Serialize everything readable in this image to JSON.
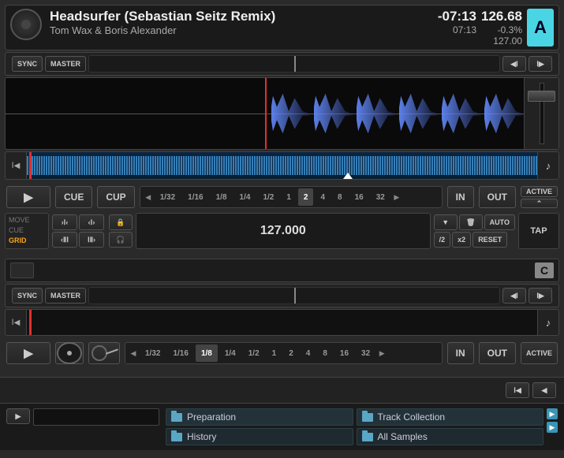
{
  "deckA": {
    "letter": "A",
    "title": "Headsurfer (Sebastian Seitz Remix)",
    "artist": "Tom Wax & Boris Alexander",
    "time_remaining": "-07:13",
    "time_elapsed": "07:13",
    "bpm_current": "126.68",
    "bpm_pct": "-0.3%",
    "bpm_orig": "127.00",
    "sync": "SYNC",
    "master": "MASTER",
    "play": "▶",
    "cue": "CUE",
    "cup": "CUP",
    "in": "IN",
    "out": "OUT",
    "active": "ACTIVE",
    "beats": [
      "1/32",
      "1/16",
      "1/8",
      "1/4",
      "1/2",
      "1",
      "2",
      "4",
      "8",
      "16",
      "32"
    ],
    "beats_selected": "2",
    "grid_tabs": {
      "move": "MOVE",
      "cue": "CUE",
      "grid": "GRID"
    },
    "bpm_field": "127.000",
    "auto": "AUTO",
    "half": "/2",
    "dbl": "x2",
    "reset": "RESET",
    "tap": "TAP"
  },
  "deckC": {
    "letter": "C",
    "sync": "SYNC",
    "master": "MASTER",
    "in": "IN",
    "out": "OUT",
    "active": "ACTIVE",
    "beats": [
      "1/32",
      "1/16",
      "1/8",
      "1/4",
      "1/2",
      "1",
      "2",
      "4",
      "8",
      "16",
      "32"
    ],
    "beats_selected": "1/8"
  },
  "browser": {
    "play_icon": "▶",
    "items_left": [
      {
        "label": "Preparation"
      },
      {
        "label": "History"
      }
    ],
    "items_right": [
      {
        "label": "Track Collection"
      },
      {
        "label": "All Samples"
      }
    ]
  }
}
